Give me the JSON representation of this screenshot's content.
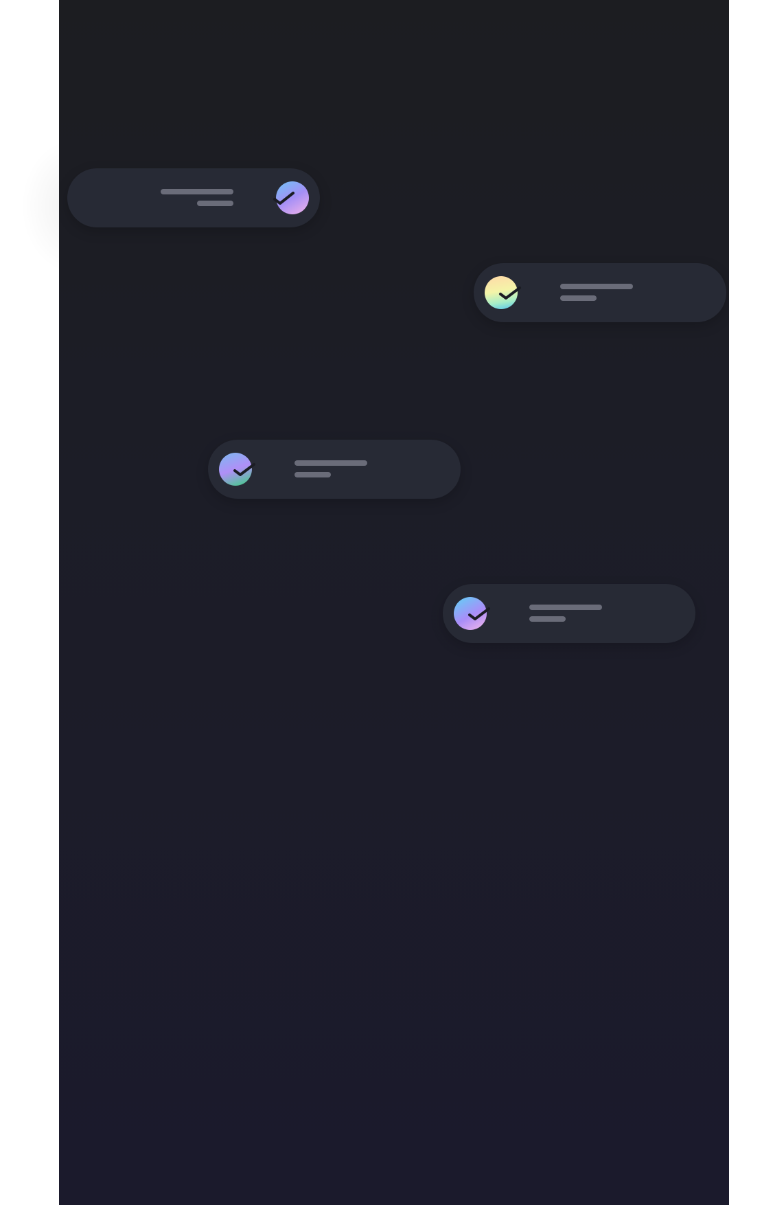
{
  "screen": {
    "background_top": "#1c1d21",
    "background_bottom": "#1b1a2c",
    "pill_color": "#272a35",
    "placeholder_line_color": "#6a6c79"
  },
  "notifications": [
    {
      "icon": "check-icon",
      "badge_gradient": "cool",
      "badge_side": "right",
      "text_align": "right"
    },
    {
      "icon": "check-icon",
      "badge_gradient": "warm",
      "badge_side": "left",
      "text_align": "left"
    },
    {
      "icon": "check-icon",
      "badge_gradient": "violet",
      "badge_side": "left",
      "text_align": "left"
    },
    {
      "icon": "check-icon",
      "badge_gradient": "sky",
      "badge_side": "left",
      "text_align": "left"
    }
  ]
}
